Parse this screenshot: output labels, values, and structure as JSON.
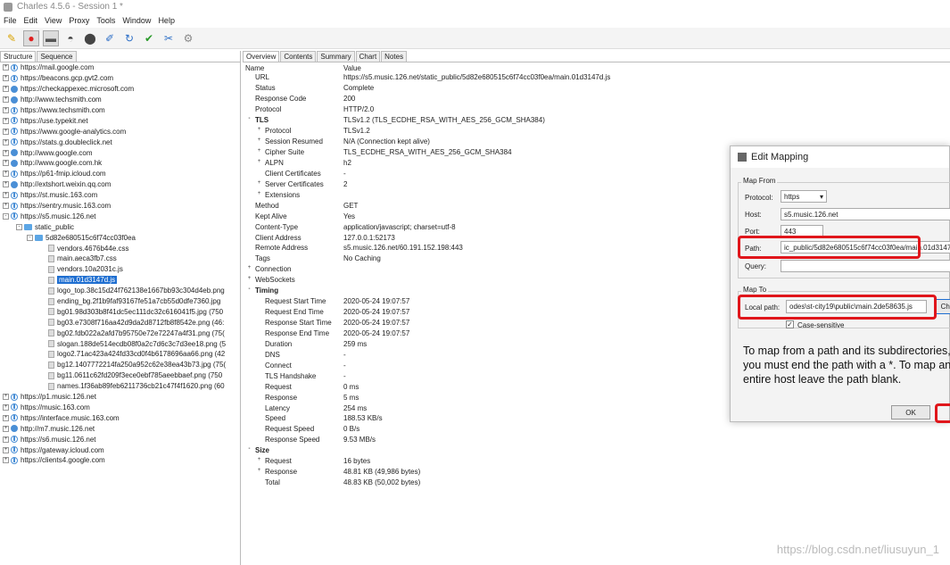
{
  "window": {
    "title": "Charles 4.5.6 - Session 1 *"
  },
  "menu": [
    "File",
    "Edit",
    "View",
    "Proxy",
    "Tools",
    "Window",
    "Help"
  ],
  "toolbar_icons": [
    "pen-icon",
    "record-icon",
    "throttle-icon",
    "turtle-icon",
    "breakpoint-icon",
    "compose-icon",
    "repeat-icon",
    "validate-icon",
    "tools-icon",
    "settings-icon"
  ],
  "left": {
    "tabs": [
      "Structure",
      "Sequence"
    ],
    "hosts_top": [
      {
        "label": "https://mail.google.com",
        "icon": "s"
      },
      {
        "label": "https://beacons.gcp.gvt2.com",
        "icon": "s"
      },
      {
        "label": "https://checkappexec.microsoft.com",
        "icon": "h"
      },
      {
        "label": "http://www.techsmith.com",
        "icon": "h"
      },
      {
        "label": "https://www.techsmith.com",
        "icon": "s"
      },
      {
        "label": "https://use.typekit.net",
        "icon": "s"
      },
      {
        "label": "https://www.google-analytics.com",
        "icon": "s"
      },
      {
        "label": "https://stats.g.doubleclick.net",
        "icon": "s"
      },
      {
        "label": "http://www.google.com",
        "icon": "h"
      },
      {
        "label": "http://www.google.com.hk",
        "icon": "h"
      },
      {
        "label": "https://p61-fmip.icloud.com",
        "icon": "s"
      },
      {
        "label": "http://extshort.weixin.qq.com",
        "icon": "h"
      },
      {
        "label": "https://st.music.163.com",
        "icon": "s"
      },
      {
        "label": "https://sentry.music.163.com",
        "icon": "s"
      },
      {
        "label": "https://s5.music.126.net",
        "icon": "s"
      }
    ],
    "folder1": "static_public",
    "folder2": "5d82e680515c6f74cc03f0ea",
    "files": [
      "vendors.4676b44e.css",
      "main.aeca3fb7.css",
      "vendors.10a2031c.js",
      "main.01d3147d.js",
      "logo_top.38c15d24f762138e1667bb93c304d4eb.png",
      "ending_bg.2f1b9faf93167fe51a7cb55d0dfe7360.jpg",
      "bg01.98d303b8f41dc5ec111dc32c616041f5.jpg (750",
      "bg03.e7308f716aa42d9da2d8712fb8f8542e.png (46:",
      "bg02.fdb022a2afd7b95750e72e72247a4f31.png (75(",
      "slogan.188de514ecdb08f0a2c7d6c3c7d3ee18.png (5",
      "logo2.71ac423a424fd33cd0f4b6178696aa66.png (42",
      "bg12.1407772214fa250a952c62e38ea43b73.jpg (75(",
      "bg11.0611c62fd209f3ece0ebf785aeebbaef.png (750",
      "names.1f36ab89feb6211736cb21c47f4f1620.png (60"
    ],
    "selected_file": "main.01d3147d.js",
    "hosts_bottom": [
      {
        "label": "https://p1.music.126.net",
        "icon": "s"
      },
      {
        "label": "https://music.163.com",
        "icon": "s"
      },
      {
        "label": "https://interface.music.163.com",
        "icon": "s"
      },
      {
        "label": "http://m7.music.126.net",
        "icon": "h"
      },
      {
        "label": "https://s6.music.126.net",
        "icon": "s"
      },
      {
        "label": "https://gateway.icloud.com",
        "icon": "s"
      },
      {
        "label": "https://clients4.google.com",
        "icon": "s"
      }
    ]
  },
  "right": {
    "tabs": [
      "Overview",
      "Contents",
      "Summary",
      "Chart",
      "Notes"
    ],
    "header": {
      "name": "Name",
      "value": "Value"
    },
    "rows": [
      {
        "k": "URL",
        "v": "https://s5.music.126.net/static_public/5d82e680515c6f74cc03f0ea/main.01d3147d.js",
        "lvl": 1
      },
      {
        "k": "Status",
        "v": "Complete",
        "lvl": 1
      },
      {
        "k": "Response Code",
        "v": "200",
        "lvl": 1
      },
      {
        "k": "Protocol",
        "v": "HTTP/2.0",
        "lvl": 1
      },
      {
        "k": "TLS",
        "v": "TLSv1.2 (TLS_ECDHE_RSA_WITH_AES_256_GCM_SHA384)",
        "lvl": 0,
        "exp": "-",
        "bold": true
      },
      {
        "k": "Protocol",
        "v": "TLSv1.2",
        "lvl": 2,
        "exp": "+"
      },
      {
        "k": "Session Resumed",
        "v": "N/A (Connection kept alive)",
        "lvl": 2,
        "exp": "+"
      },
      {
        "k": "Cipher Suite",
        "v": "TLS_ECDHE_RSA_WITH_AES_256_GCM_SHA384",
        "lvl": 2,
        "exp": "+"
      },
      {
        "k": "ALPN",
        "v": "h2",
        "lvl": 2,
        "exp": "+"
      },
      {
        "k": "Client Certificates",
        "v": "-",
        "lvl": 2
      },
      {
        "k": "Server Certificates",
        "v": "2",
        "lvl": 2,
        "exp": "+"
      },
      {
        "k": "Extensions",
        "v": "",
        "lvl": 2,
        "exp": "+"
      },
      {
        "k": "Method",
        "v": "GET",
        "lvl": 1
      },
      {
        "k": "Kept Alive",
        "v": "Yes",
        "lvl": 1
      },
      {
        "k": "Content-Type",
        "v": "application/javascript; charset=utf-8",
        "lvl": 1
      },
      {
        "k": "Client Address",
        "v": "127.0.0.1:52173",
        "lvl": 1
      },
      {
        "k": "Remote Address",
        "v": "s5.music.126.net/60.191.152.198:443",
        "lvl": 1
      },
      {
        "k": "Tags",
        "v": "No Caching",
        "lvl": 1
      },
      {
        "k": "Connection",
        "v": "",
        "lvl": 0,
        "exp": "+"
      },
      {
        "k": "WebSockets",
        "v": "",
        "lvl": 0,
        "exp": "+"
      },
      {
        "k": "Timing",
        "v": "",
        "lvl": 0,
        "exp": "-",
        "bold": true
      },
      {
        "k": "Request Start Time",
        "v": "2020-05-24 19:07:57",
        "lvl": 2
      },
      {
        "k": "Request End Time",
        "v": "2020-05-24 19:07:57",
        "lvl": 2
      },
      {
        "k": "Response Start Time",
        "v": "2020-05-24 19:07:57",
        "lvl": 2
      },
      {
        "k": "Response End Time",
        "v": "2020-05-24 19:07:57",
        "lvl": 2
      },
      {
        "k": "Duration",
        "v": "259 ms",
        "lvl": 2
      },
      {
        "k": "DNS",
        "v": "-",
        "lvl": 2
      },
      {
        "k": "Connect",
        "v": "-",
        "lvl": 2
      },
      {
        "k": "TLS Handshake",
        "v": "-",
        "lvl": 2
      },
      {
        "k": "Request",
        "v": "0 ms",
        "lvl": 2
      },
      {
        "k": "Response",
        "v": "5 ms",
        "lvl": 2
      },
      {
        "k": "Latency",
        "v": "254 ms",
        "lvl": 2
      },
      {
        "k": "Speed",
        "v": "188.53 KB/s",
        "lvl": 2
      },
      {
        "k": "Request Speed",
        "v": "0 B/s",
        "lvl": 2
      },
      {
        "k": "Response Speed",
        "v": "9.53 MB/s",
        "lvl": 2
      },
      {
        "k": "Size",
        "v": "",
        "lvl": 0,
        "exp": "-",
        "bold": true
      },
      {
        "k": "Request",
        "v": "16 bytes",
        "lvl": 2,
        "exp": "+"
      },
      {
        "k": "Response",
        "v": "48.81 KB (49,986 bytes)",
        "lvl": 2,
        "exp": "+"
      },
      {
        "k": "Total",
        "v": "48.83 KB (50,002 bytes)",
        "lvl": 2
      }
    ]
  },
  "dialog": {
    "title": "Edit Mapping",
    "map_from": "Map From",
    "protocol_label": "Protocol:",
    "protocol_value": "https",
    "host_label": "Host:",
    "host_value": "s5.music.126.net",
    "port_label": "Port:",
    "port_value": "443",
    "path_label": "Path:",
    "path_value": "ic_public/5d82e680515c6f74cc03f0ea/main.01d3147d.js",
    "query_label": "Query:",
    "query_value": "",
    "map_to": "Map To",
    "local_label": "Local path:",
    "local_value": "odes\\st-city19\\public\\main.2de58635.js",
    "choose": "Cho",
    "case_label": "Case-sensitive",
    "hint1": "To map from a path and its subdirectories,",
    "hint2": "you must end the path with a *. To map an",
    "hint3": "entire host leave the path blank.",
    "ok": "OK"
  },
  "watermark": "https://blog.csdn.net/liusuyun_1",
  "colors": {
    "selection": "#1f6fd1",
    "highlight": "#e0161b"
  }
}
